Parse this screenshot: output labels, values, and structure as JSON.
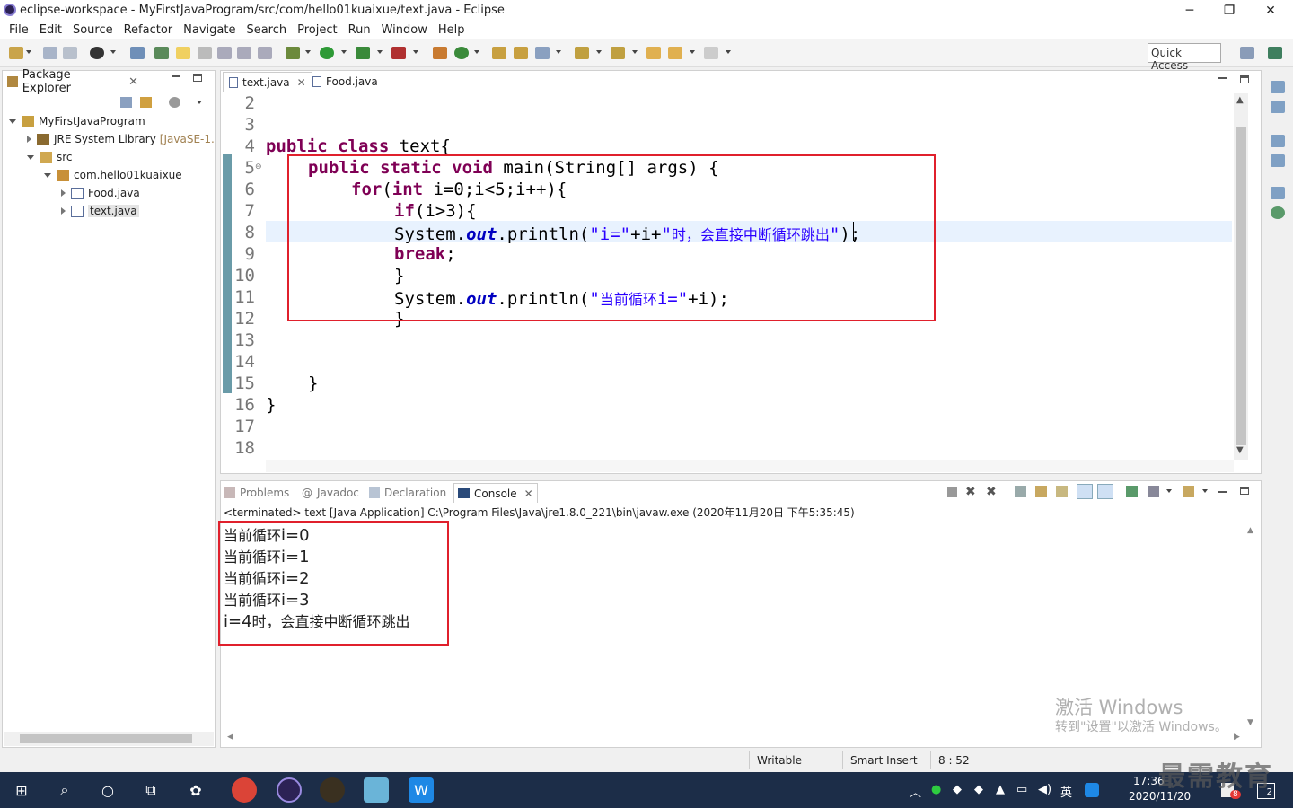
{
  "window": {
    "title": "eclipse-workspace - MyFirstJavaProgram/src/com/hello01kuaixue/text.java - Eclipse",
    "minimize": "─",
    "restore": "❐",
    "close": "✕"
  },
  "menu": [
    "File",
    "Edit",
    "Source",
    "Refactor",
    "Navigate",
    "Search",
    "Project",
    "Run",
    "Window",
    "Help"
  ],
  "quick_access": "Quick Access",
  "package_explorer": {
    "tab_label": "Package Explorer",
    "tree": [
      {
        "label": "MyFirstJavaProgram",
        "suffix": ""
      },
      {
        "label": "JRE System Library",
        "suffix": "[JavaSE-1."
      },
      {
        "label": "src",
        "suffix": ""
      },
      {
        "label": "com.hello01kuaixue",
        "suffix": ""
      },
      {
        "label": "Food.java",
        "suffix": ""
      },
      {
        "label": "text.java",
        "suffix": ""
      }
    ]
  },
  "editor": {
    "tabs": [
      {
        "label": "text.java"
      },
      {
        "label": "Food.java"
      }
    ],
    "line_numbers": [
      "2",
      "3",
      "4",
      "5",
      "6",
      "7",
      "8",
      "9",
      "10",
      "11",
      "12",
      "13",
      "14",
      "15",
      "16",
      "17",
      "18"
    ],
    "code": {
      "l4_kw": "public class",
      "l4_rest": " text{",
      "l5_kw": "public static void",
      "l5_rest": " main(String[] args) {",
      "l6_kw": "for",
      "l6_a": "(",
      "l6_kw2": "int",
      "l6_rest": " i=0;i<5;i++){",
      "l7_kw": "if",
      "l7_rest": "(i>3){",
      "l8_a": "System.",
      "l8_field": "out",
      "l8_b": ".println(",
      "l8_s1": "\"i=\"",
      "l8_c": "+i+",
      "l8_s2a": "\"",
      "l8_s2cn": "时，会直接中断循环跳出",
      "l8_s2b": "\"",
      "l8_d": ");",
      "l9_kw": "break",
      "l9_rest": ";",
      "l10": "}",
      "l11_a": "System.",
      "l11_field": "out",
      "l11_b": ".println(",
      "l11_s1": "\"",
      "l11_scn": "当前循环",
      "l11_s2": "i=\"",
      "l11_c": "+i);",
      "l12": "}",
      "l15": "}",
      "l16": "}"
    }
  },
  "console": {
    "tabs": [
      "Problems",
      "Javadoc",
      "Declaration",
      "Console"
    ],
    "terminated": "<terminated> text [Java Application] C:\\Program Files\\Java\\jre1.8.0_221\\bin\\javaw.exe (2020年11月20日 下午5:35:45)",
    "output": [
      {
        "cn": "当前循环",
        "v": "i=0"
      },
      {
        "cn": "当前循环",
        "v": "i=1"
      },
      {
        "cn": "当前循环",
        "v": "i=2"
      },
      {
        "cn": "当前循环",
        "v": "i=3"
      }
    ],
    "last_line_a": "i=4",
    "last_line_b": "时，会直接中断循环跳出"
  },
  "watermark": {
    "line1": "激活 Windows",
    "line2": "转到\"设置\"以激活 Windows。"
  },
  "status": {
    "writable": "Writable",
    "insert_mode": "Smart Insert",
    "position": "8 : 52"
  },
  "taskbar": {
    "time": "17:36",
    "date": "2020/11/20",
    "ime": "英",
    "notif_count": "2",
    "badge": "8",
    "brand_watermark": "最需教育"
  },
  "colors": {
    "keyword": "#7f0055",
    "string": "#2a00ff",
    "field": "#0000c0",
    "highlight_box": "#e0202c"
  }
}
